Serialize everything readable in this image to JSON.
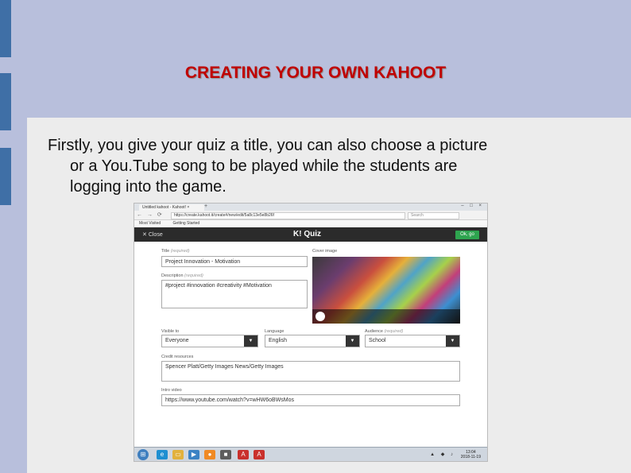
{
  "slide": {
    "title": "CREATING YOUR OWN KAHOOT",
    "body_lines": [
      "Firstly, you give your quiz a title, you can also choose a picture",
      "or a You.Tube song to be played while the students are",
      "logging into the game."
    ]
  },
  "browser": {
    "tab_title": "Untitled kahoot - Kahoot! ×",
    "new_tab": "+",
    "window_controls": "– □ ×",
    "nav_icons": "← → ⟳",
    "url": "https://create.kahoot.it/create#/new/edit/5a8c13e5e8b26f",
    "search_placeholder": "Search",
    "bookmarks": [
      "Most Visited",
      "Getting Started"
    ]
  },
  "kahoot": {
    "close_label": "Close",
    "logo": "K! Quiz",
    "go_label": "Ok, go",
    "title_label": "Title",
    "title_required": "(required)",
    "title_value": "Project Innovation - Motivation",
    "description_label": "Description",
    "description_required": "(required)",
    "description_value": "#project #innovation #creativity #Motivation",
    "cover_label": "Cover image",
    "visible_label": "Visible to",
    "visible_value": "Everyone",
    "language_label": "Language",
    "language_value": "English",
    "audience_label": "Audience",
    "audience_required": "(required)",
    "audience_value": "School",
    "credit_label": "Credit resources",
    "credit_value": "Spencer Platt/Getty Images News/Getty Images",
    "intro_label": "Intro video",
    "intro_value": "https://www.youtube.com/watch?v=wHW6oBWsMos"
  },
  "taskbar": {
    "start_icon": "windows-start-icon",
    "tray": "▲ ◆ ♪",
    "time": "13:04",
    "date": "2018-11-19"
  },
  "colors": {
    "background": "#b8bfdc",
    "content": "#ececec",
    "title": "#c00000",
    "accent_bar": "#3f6fa6",
    "kahoot_bar": "#2b2b2b",
    "go_button": "#2ea44f"
  }
}
